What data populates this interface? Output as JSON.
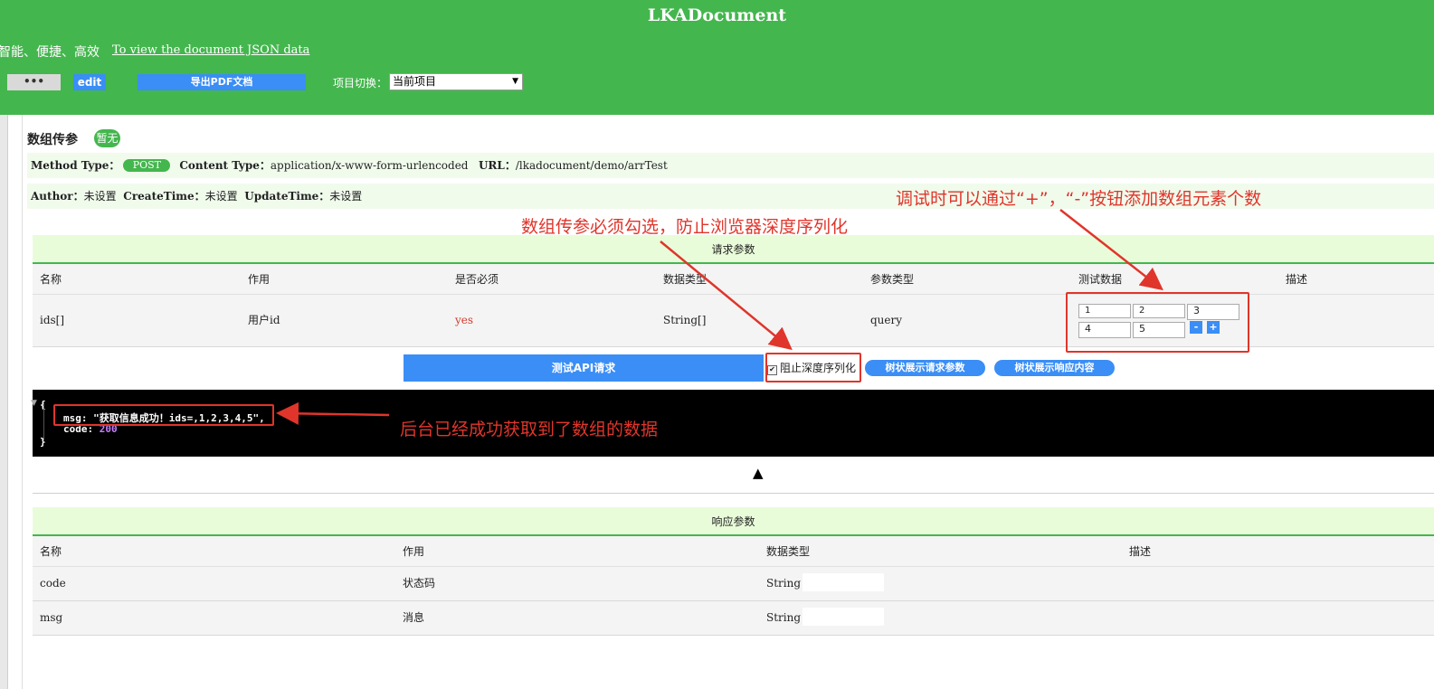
{
  "header": {
    "app_title": "LKADocument",
    "tagline": "智能、便捷、高效",
    "json_link": "To view the document JSON data",
    "more_button": "•••",
    "edit_button": "edit",
    "export_pdf_button": "导出PDF文档",
    "project_switch_label": "项目切换：",
    "project_select_value": "当前项目"
  },
  "api": {
    "name": "数组传参",
    "status_badge": "暂无",
    "method_type_label": "Method Type：",
    "method": "POST",
    "content_type_label": "Content Type：",
    "content_type": "application/x-www-form-urlencoded",
    "url_label": "URL：",
    "url": "/lkadocument/demo/arrTest",
    "author_label": "Author：",
    "author": "未设置",
    "create_time_label": "CreateTime：",
    "create_time": "未设置",
    "update_time_label": "UpdateTime：",
    "update_time": "未设置"
  },
  "request_params": {
    "title": "请求参数",
    "columns": [
      "名称",
      "作用",
      "是否必须",
      "数据类型",
      "参数类型",
      "测试数据",
      "描述"
    ],
    "rows": [
      {
        "name": "ids[]",
        "purpose": "用户id",
        "required": "yes",
        "data_type": "String[]",
        "param_type": "query",
        "test_values": [
          "1",
          "2",
          "3",
          "4",
          "5"
        ]
      }
    ],
    "minus_button": "-",
    "plus_button": "+"
  },
  "actions": {
    "test_button": "测试API请求",
    "prevent_deep_serialize_label": "阻止深度序列化",
    "prevent_deep_serialize_checked": true,
    "tree_request_button": "树状展示请求参数",
    "tree_response_button": "树状展示响应内容"
  },
  "console": {
    "open_brace": "{",
    "msg_line": "msg: \"获取信息成功！ids=,1,2,3,4,5\",",
    "code_key": "code: ",
    "code_value": "200",
    "close_brace": "}"
  },
  "response_params": {
    "title": "响应参数",
    "columns": [
      "名称",
      "作用",
      "数据类型",
      "描述"
    ],
    "rows": [
      {
        "name": "code",
        "purpose": "状态码",
        "data_type": "String"
      },
      {
        "name": "msg",
        "purpose": "消息",
        "data_type": "String"
      }
    ]
  },
  "annotations": {
    "plus_minus_note": "调试时可以通过“+”，“-”按钮添加数组元素个数",
    "checkbox_note": "数组传参必须勾选，防止浏览器深度序列化",
    "result_note": "后台已经成功获取到了数组的数据"
  },
  "colors": {
    "header_green": "#44b64e",
    "button_blue": "#3a8ef6",
    "annotation_red": "#e0352b",
    "console_bg": "#000000"
  }
}
